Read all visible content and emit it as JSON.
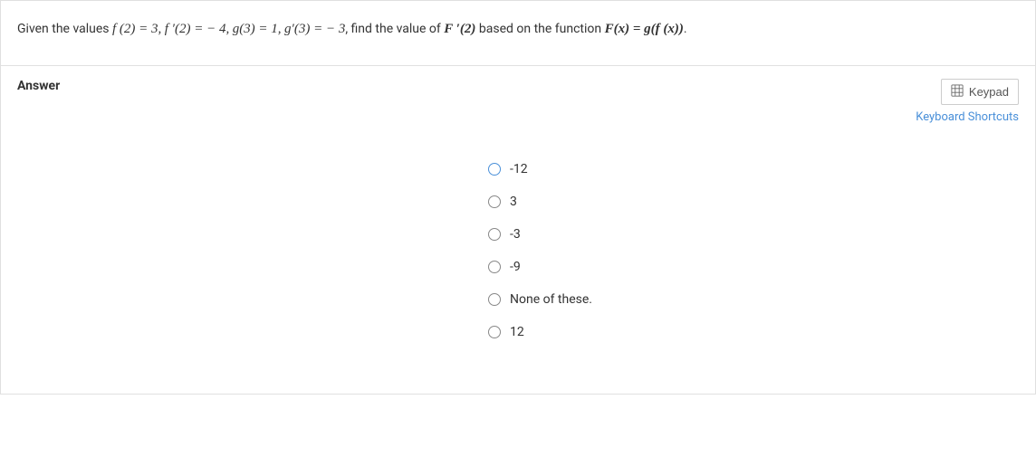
{
  "question": {
    "prefix": "Given the values",
    "f2": "f (2) = 3,",
    "fp2": "f ′(2) = − 4,",
    "g3": "g(3) = 1,",
    "gp3": "g′(3) = − 3",
    "middle": ", find the value of",
    "Fp2": "F ′(2)",
    "middle2": "based on the function",
    "Fx": "F(x) = g(f (x))",
    "suffix": "."
  },
  "answer_label": "Answer",
  "keypad_label": "Keypad",
  "shortcuts_label": "Keyboard Shortcuts",
  "options": [
    {
      "label": "-12",
      "hovered": true
    },
    {
      "label": "3",
      "hovered": false
    },
    {
      "label": "-3",
      "hovered": false
    },
    {
      "label": "-9",
      "hovered": false
    },
    {
      "label": "None of these.",
      "hovered": false
    },
    {
      "label": "12",
      "hovered": false
    }
  ]
}
